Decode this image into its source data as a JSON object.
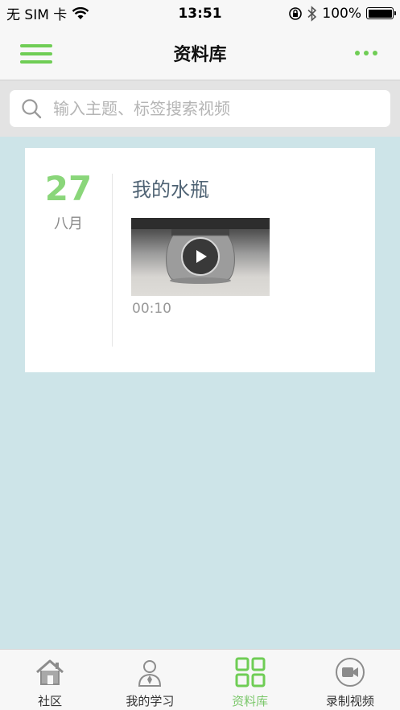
{
  "status_bar": {
    "carrier": "无 SIM 卡",
    "time": "13:51",
    "battery": "100%"
  },
  "nav": {
    "title": "资料库"
  },
  "search": {
    "placeholder": "输入主题、标签搜索视频",
    "value": ""
  },
  "entry": {
    "day": "27",
    "month": "八月",
    "title": "我的水瓶",
    "duration": "00:10"
  },
  "tabs": [
    {
      "label": "社区",
      "icon": "home-icon",
      "active": false
    },
    {
      "label": "我的学习",
      "icon": "person-icon",
      "active": false
    },
    {
      "label": "资料库",
      "icon": "grid-icon",
      "active": true
    },
    {
      "label": "录制视频",
      "icon": "video-camera-icon",
      "active": false
    }
  ],
  "colors": {
    "accent": "#6fcd55",
    "background": "#cde4e8",
    "date_green": "#8ad67a",
    "title_slate": "#4f6374"
  }
}
